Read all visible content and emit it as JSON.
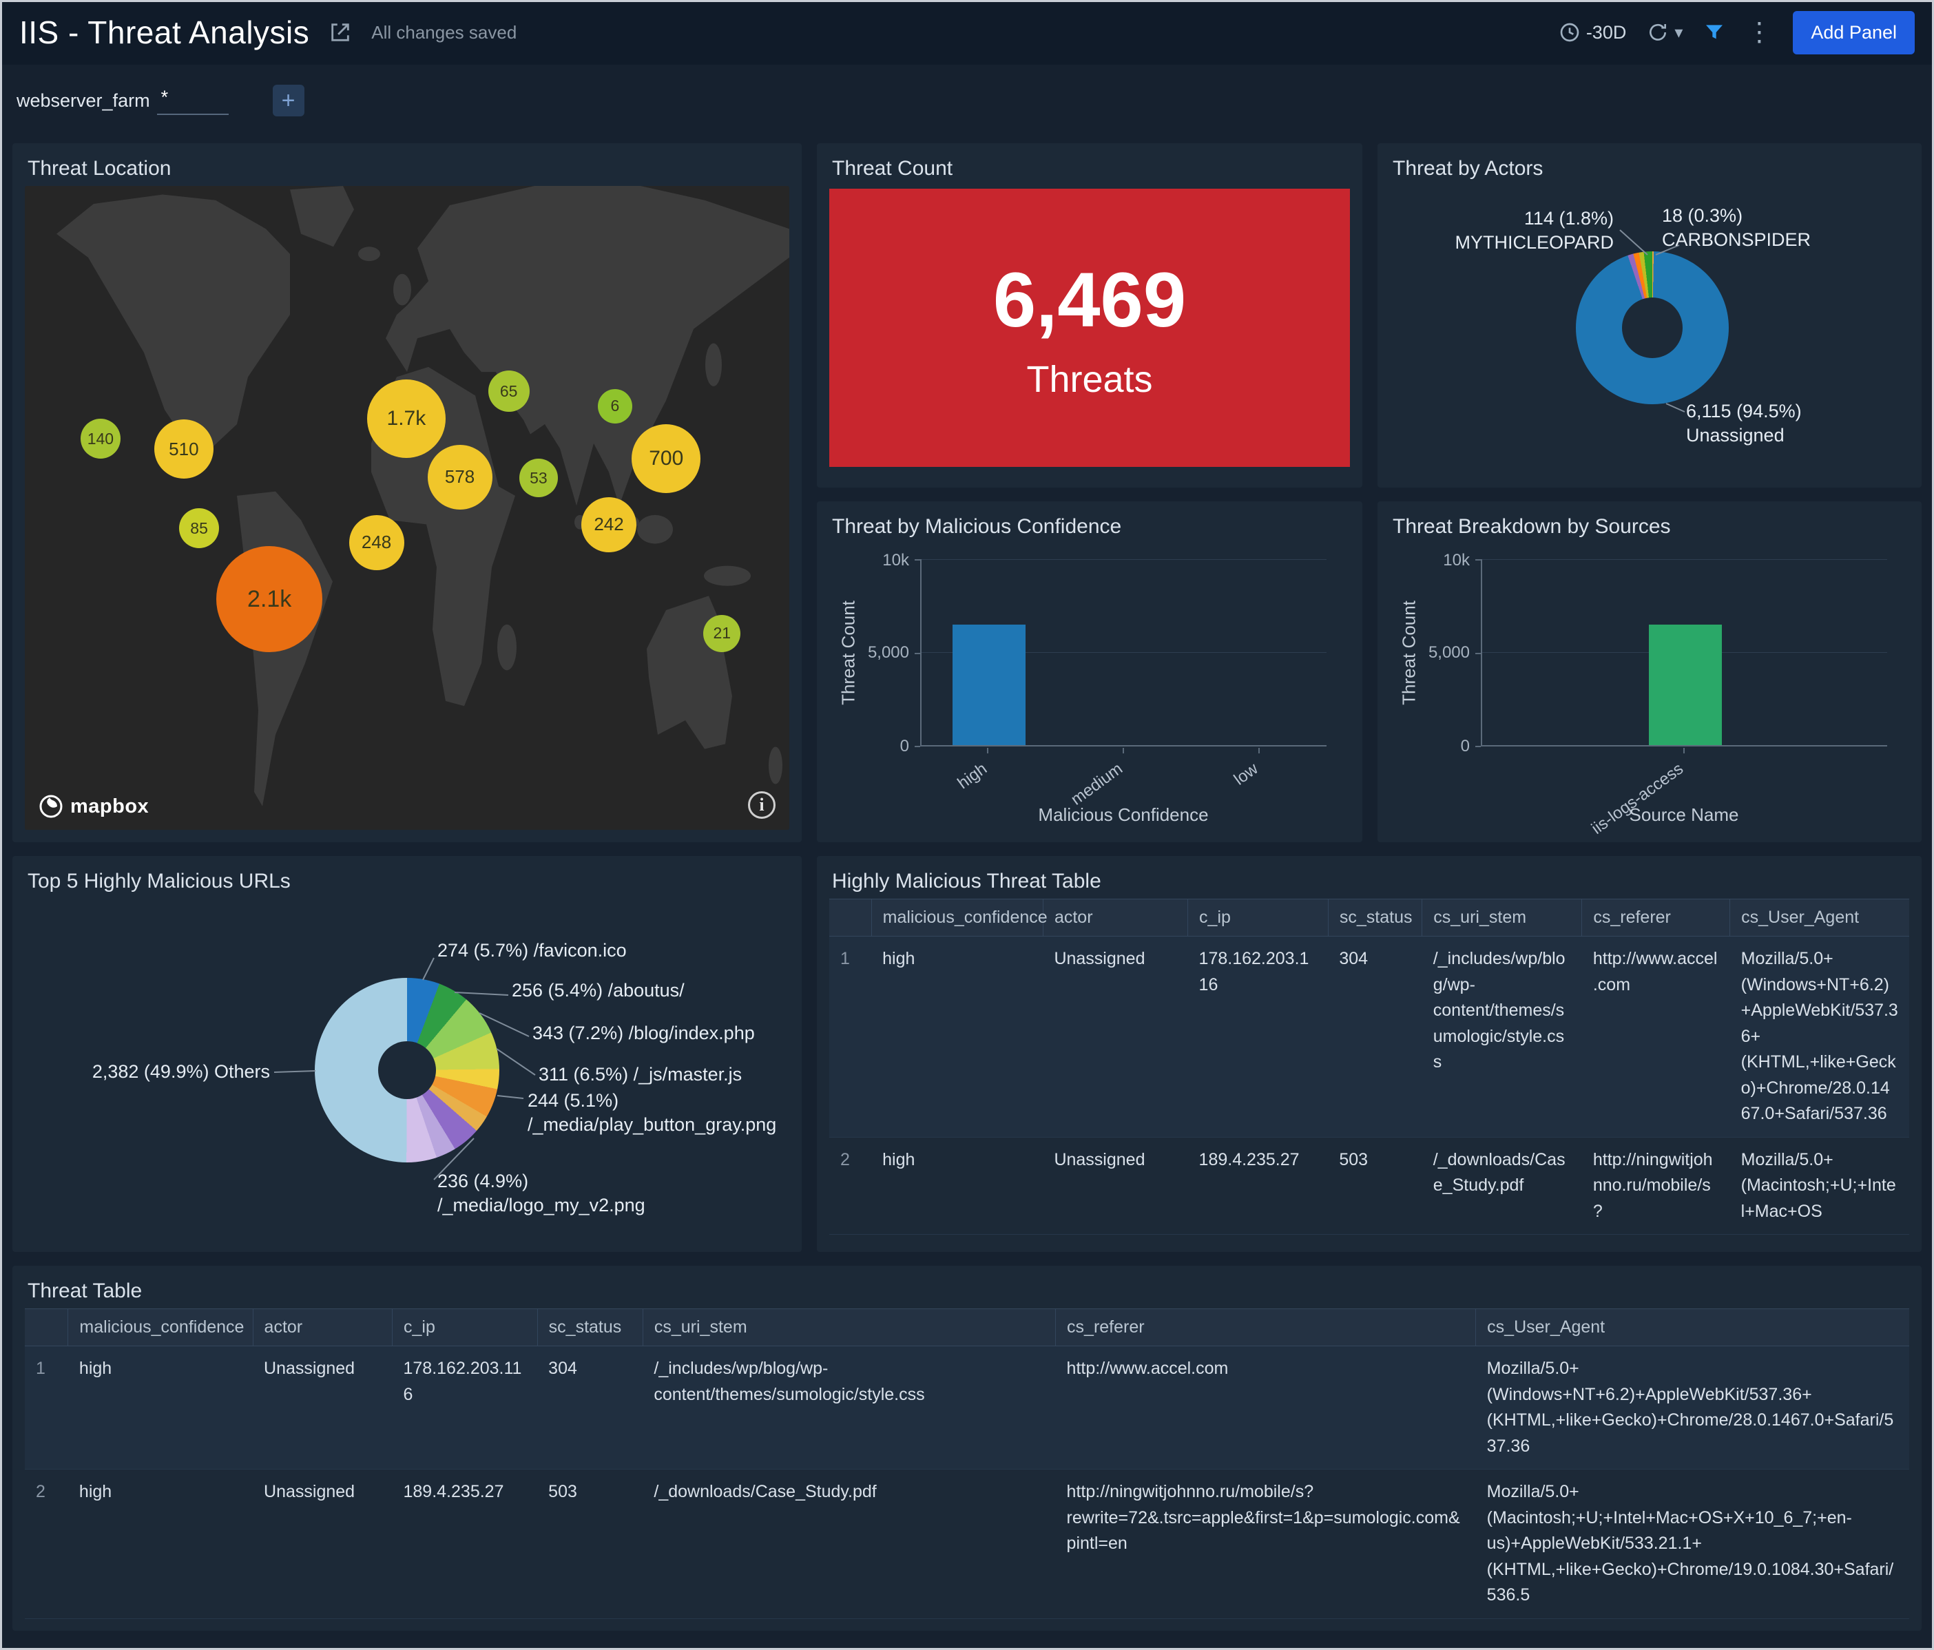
{
  "header": {
    "title": "IIS - Threat Analysis",
    "saved_status": "All changes saved",
    "time_range": "-30D",
    "add_panel_label": "Add Panel"
  },
  "filter": {
    "label": "webserver_farm",
    "value": "*",
    "add_button": "+"
  },
  "map": {
    "title": "Threat Location",
    "attribution": "mapbox",
    "info_icon": "i",
    "markers": [
      {
        "label": "140",
        "x": 9.9,
        "y": 39.3,
        "size": 58,
        "color": "#a6c531"
      },
      {
        "label": "510",
        "x": 20.8,
        "y": 40.9,
        "size": 86,
        "color": "#f0c62a"
      },
      {
        "label": "85",
        "x": 22.8,
        "y": 53.2,
        "size": 58,
        "color": "#c9d02a"
      },
      {
        "label": "2.1k",
        "x": 32.0,
        "y": 64.2,
        "size": 154,
        "color": "#e96e12"
      },
      {
        "label": "248",
        "x": 46.0,
        "y": 55.4,
        "size": 80,
        "color": "#f0c62a"
      },
      {
        "label": "1.7k",
        "x": 49.9,
        "y": 36.2,
        "size": 114,
        "color": "#f0c62a"
      },
      {
        "label": "578",
        "x": 56.9,
        "y": 45.2,
        "size": 94,
        "color": "#f0c62a"
      },
      {
        "label": "65",
        "x": 63.3,
        "y": 31.9,
        "size": 60,
        "color": "#a6c531"
      },
      {
        "label": "53",
        "x": 67.2,
        "y": 45.4,
        "size": 56,
        "color": "#a6c531"
      },
      {
        "label": "6",
        "x": 77.2,
        "y": 34.2,
        "size": 50,
        "color": "#8fc32c"
      },
      {
        "label": "700",
        "x": 83.9,
        "y": 42.3,
        "size": 100,
        "color": "#f0c62a"
      },
      {
        "label": "242",
        "x": 76.4,
        "y": 52.6,
        "size": 80,
        "color": "#f0c62a"
      },
      {
        "label": "21",
        "x": 91.2,
        "y": 69.5,
        "size": 54,
        "color": "#a6c531"
      }
    ]
  },
  "threat_count": {
    "title": "Threat Count",
    "value": "6,469",
    "unit": "Threats"
  },
  "actors": {
    "title": "Threat by Actors",
    "callouts": {
      "mythicleopard": {
        "value": "114 (1.8%)",
        "name": "MYTHICLEOPARD"
      },
      "carbonspider": {
        "value": "18 (0.3%)",
        "name": "CARBONSPIDER"
      },
      "unassigned": {
        "value": "6,115 (94.5%)",
        "name": "Unassigned"
      }
    }
  },
  "confidence": {
    "title": "Threat by Malicious Confidence",
    "ylabel": "Threat Count",
    "xlabel": "Malicious Confidence",
    "yticks": [
      "10k",
      "5,000",
      "0"
    ],
    "categories": [
      "high",
      "medium",
      "low"
    ]
  },
  "sources": {
    "title": "Threat Breakdown by Sources",
    "ylabel": "Threat Count",
    "xlabel": "Source Name",
    "yticks": [
      "10k",
      "5,000",
      "0"
    ],
    "categories": [
      "iis-logs-access"
    ]
  },
  "urls": {
    "title": "Top 5 Highly Malicious URLs",
    "others_label": "2,382 (49.9%) Others",
    "callouts": [
      "274 (5.7%) /favicon.ico",
      "256 (5.4%) /aboutus/",
      "343 (7.2%) /blog/index.php",
      "311 (6.5%) /_js/master.js",
      "244 (5.1%) /_media/play_button_gray.png",
      "236 (4.9%) /_media/logo_my_v2.png"
    ]
  },
  "hm_table": {
    "title": "Highly Malicious Threat Table",
    "columns": [
      "malicious_confidence",
      "actor",
      "c_ip",
      "sc_status",
      "cs_uri_stem",
      "cs_referer",
      "cs_User_Agent"
    ],
    "rows": [
      [
        "1",
        "high",
        "Unassigned",
        "178.162.203.116",
        "304",
        "/_includes/wp/blog/wp-content/themes/sumologic/style.css",
        "http://www.accel.com",
        "Mozilla/5.0+(Windows+NT+6.2)+AppleWebKit/537.36+(KHTML,+like+Gecko)+Chrome/28.0.1467.0+Safari/537.36"
      ],
      [
        "2",
        "high",
        "Unassigned",
        "189.4.235.27",
        "503",
        "/_downloads/Case_Study.pdf",
        "http://ningwitjohnno.ru/mobile/s?",
        "Mozilla/5.0+(Macintosh;+U;+Intel+Mac+OS"
      ]
    ]
  },
  "threat_table": {
    "title": "Threat Table",
    "columns": [
      "malicious_confidence",
      "actor",
      "c_ip",
      "sc_status",
      "cs_uri_stem",
      "cs_referer",
      "cs_User_Agent"
    ],
    "rows": [
      [
        "1",
        "high",
        "Unassigned",
        "178.162.203.116",
        "304",
        "/_includes/wp/blog/wp-content/themes/sumologic/style.css",
        "http://www.accel.com",
        "Mozilla/5.0+(Windows+NT+6.2)+AppleWebKit/537.36+(KHTML,+like+Gecko)+Chrome/28.0.1467.0+Safari/537.36"
      ],
      [
        "2",
        "high",
        "Unassigned",
        "189.4.235.27",
        "503",
        "/_downloads/Case_Study.pdf",
        "http://ningwitjohnno.ru/mobile/s?rewrite=72&.tsrc=apple&first=1&p=sumologic.com&pintl=en",
        "Mozilla/5.0+(Macintosh;+U;+Intel+Mac+OS+X+10_6_7;+en-us)+AppleWebKit/533.21.1+(KHTML,+like+Gecko)+Chrome/19.0.1084.30+Safari/536.5"
      ]
    ]
  },
  "chart_data": [
    {
      "id": "threat_by_actors",
      "type": "pie",
      "title": "Threat by Actors",
      "slices": [
        {
          "label": "CARBONSPIDER",
          "value": 18,
          "pct": 0.3,
          "color": "#e8a33d"
        },
        {
          "label": "Unassigned",
          "value": 6115,
          "pct": 94.5,
          "color": "#1f77b4"
        },
        {
          "label": "",
          "value": null,
          "pct": 1.2,
          "color": "#9467bd"
        },
        {
          "label": "",
          "value": null,
          "pct": 1.2,
          "color": "#ff7f0e"
        },
        {
          "label": "",
          "value": null,
          "pct": 1.0,
          "color": "#bcbd22"
        },
        {
          "label": "MYTHICLEOPARD",
          "value": 114,
          "pct": 1.8,
          "color": "#2ca02c"
        }
      ]
    },
    {
      "id": "threat_by_malicious_confidence",
      "type": "bar",
      "title": "Threat by Malicious Confidence",
      "categories": [
        "high",
        "medium",
        "low"
      ],
      "values": [
        6469,
        0,
        0
      ],
      "ylim": [
        0,
        10000
      ],
      "color": "#1f77b4",
      "xlabel": "Malicious Confidence",
      "ylabel": "Threat Count"
    },
    {
      "id": "threat_breakdown_by_sources",
      "type": "bar",
      "title": "Threat Breakdown by Sources",
      "categories": [
        "iis-logs-access"
      ],
      "values": [
        6469
      ],
      "ylim": [
        0,
        10000
      ],
      "color": "#2aa868",
      "xlabel": "Source Name",
      "ylabel": "Threat Count"
    },
    {
      "id": "top_5_highly_malicious_urls",
      "type": "pie",
      "title": "Top 5 Highly Malicious URLs",
      "slices": [
        {
          "label": "/favicon.ico",
          "value": 274,
          "pct": 5.7,
          "color": "#2077c4"
        },
        {
          "label": "/aboutus/",
          "value": 256,
          "pct": 5.4,
          "color": "#2f9e44"
        },
        {
          "label": "/blog/index.php",
          "value": 343,
          "pct": 7.2,
          "color": "#8fce5a"
        },
        {
          "label": "/_js/master.js",
          "value": 311,
          "pct": 6.5,
          "color": "#c9d64b"
        },
        {
          "label": "",
          "value": null,
          "pct": 3.5,
          "color": "#f2d13d"
        },
        {
          "label": "/_media/play_button_gray.png",
          "value": 244,
          "pct": 5.1,
          "color": "#f0962f"
        },
        {
          "label": "",
          "value": null,
          "pct": 3.0,
          "color": "#e8b04a"
        },
        {
          "label": "/_media/logo_my_v2.png",
          "value": 236,
          "pct": 4.9,
          "color": "#8e6bc8"
        },
        {
          "label": "",
          "value": null,
          "pct": 3.5,
          "color": "#b9a6de"
        },
        {
          "label": "",
          "value": null,
          "pct": 5.3,
          "color": "#d3c0ea"
        },
        {
          "label": "Others",
          "value": 2382,
          "pct": 49.9,
          "color": "#a6cee3"
        }
      ]
    }
  ]
}
